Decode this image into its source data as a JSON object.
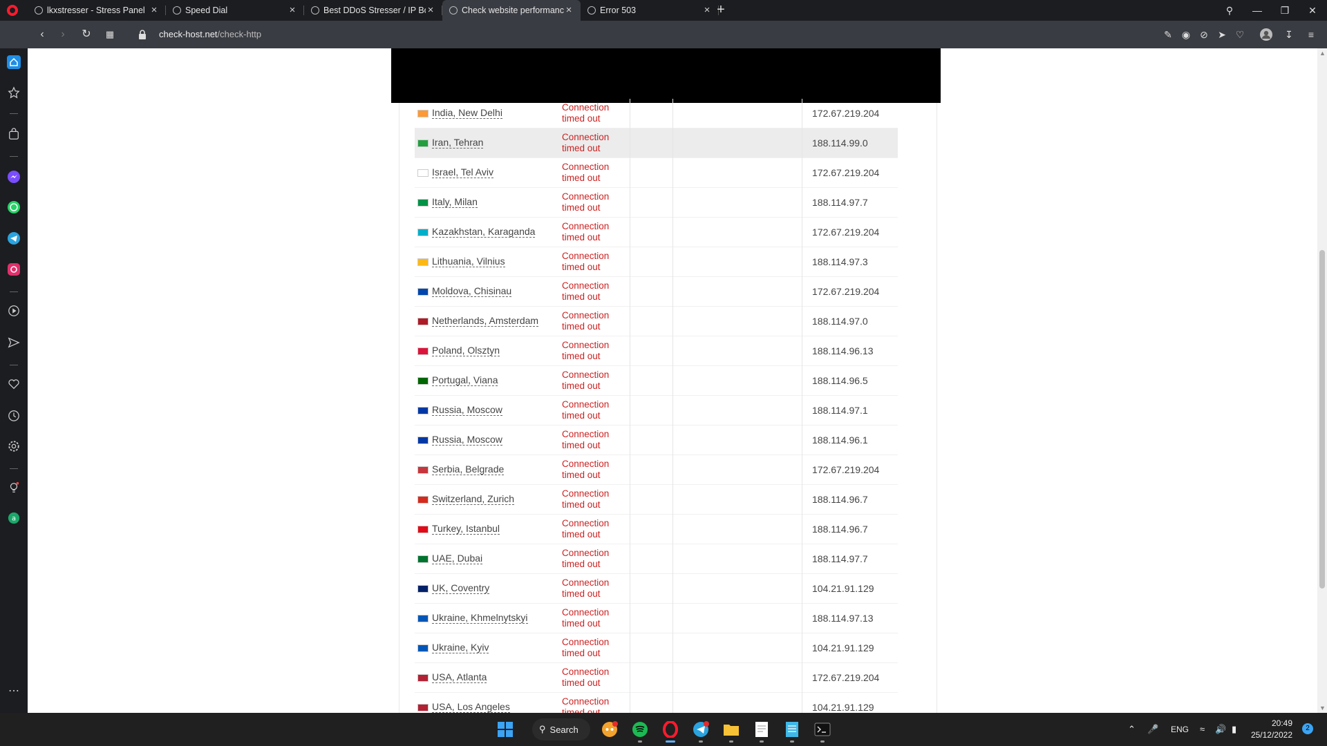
{
  "tabs": [
    {
      "label": "lkxstresser - Stress Panel",
      "active": false
    },
    {
      "label": "Speed Dial",
      "active": false
    },
    {
      "label": "Best DDoS Stresser / IP Boo",
      "active": false
    },
    {
      "label": "Check website performanc",
      "active": true
    },
    {
      "label": "Error 503",
      "active": false
    }
  ],
  "address_bar": {
    "domain": "check-host.net",
    "path": "/check-http"
  },
  "results": [
    {
      "location": "India, New Delhi",
      "flag": "india",
      "status": [
        "Connection",
        "timed out"
      ],
      "ip": "172.67.219.204",
      "highlight": false
    },
    {
      "location": "Iran, Tehran",
      "flag": "iran",
      "status": [
        "Connection",
        "timed out"
      ],
      "ip": "188.114.99.0",
      "highlight": true
    },
    {
      "location": "Israel, Tel Aviv",
      "flag": "israel",
      "status": [
        "Connection",
        "timed out"
      ],
      "ip": "172.67.219.204",
      "highlight": false
    },
    {
      "location": "Italy, Milan",
      "flag": "italy",
      "status": [
        "Connection",
        "timed out"
      ],
      "ip": "188.114.97.7",
      "highlight": false
    },
    {
      "location": "Kazakhstan, Karaganda",
      "flag": "kazakhstan",
      "status": [
        "Connection",
        "timed out"
      ],
      "ip": "172.67.219.204",
      "highlight": false
    },
    {
      "location": "Lithuania, Vilnius",
      "flag": "lithuania",
      "status": [
        "Connection",
        "timed out"
      ],
      "ip": "188.114.97.3",
      "highlight": false
    },
    {
      "location": "Moldova, Chisinau",
      "flag": "moldova",
      "status": [
        "Connection",
        "timed out"
      ],
      "ip": "172.67.219.204",
      "highlight": false
    },
    {
      "location": "Netherlands, Amsterdam",
      "flag": "netherlands",
      "status": [
        "Connection",
        "timed out"
      ],
      "ip": "188.114.97.0",
      "highlight": false
    },
    {
      "location": "Poland, Olsztyn",
      "flag": "poland",
      "status": [
        "Connection",
        "timed out"
      ],
      "ip": "188.114.96.13",
      "highlight": false
    },
    {
      "location": "Portugal, Viana",
      "flag": "portugal",
      "status": [
        "Connection",
        "timed out"
      ],
      "ip": "188.114.96.5",
      "highlight": false
    },
    {
      "location": "Russia, Moscow",
      "flag": "russia",
      "status": [
        "Connection",
        "timed out"
      ],
      "ip": "188.114.97.1",
      "highlight": false
    },
    {
      "location": "Russia, Moscow",
      "flag": "russia",
      "status": [
        "Connection",
        "timed out"
      ],
      "ip": "188.114.96.1",
      "highlight": false
    },
    {
      "location": "Serbia, Belgrade",
      "flag": "serbia",
      "status": [
        "Connection",
        "timed out"
      ],
      "ip": "172.67.219.204",
      "highlight": false
    },
    {
      "location": "Switzerland, Zurich",
      "flag": "switzerland",
      "status": [
        "Connection",
        "timed out"
      ],
      "ip": "188.114.96.7",
      "highlight": false
    },
    {
      "location": "Turkey, Istanbul",
      "flag": "turkey",
      "status": [
        "Connection",
        "timed out"
      ],
      "ip": "188.114.96.7",
      "highlight": false
    },
    {
      "location": "UAE, Dubai",
      "flag": "uae",
      "status": [
        "Connection",
        "timed out"
      ],
      "ip": "188.114.97.7",
      "highlight": false
    },
    {
      "location": "UK, Coventry",
      "flag": "uk",
      "status": [
        "Connection",
        "timed out"
      ],
      "ip": "104.21.91.129",
      "highlight": false
    },
    {
      "location": "Ukraine, Khmelnytskyi",
      "flag": "ukraine",
      "status": [
        "Connection",
        "timed out"
      ],
      "ip": "188.114.97.13",
      "highlight": false
    },
    {
      "location": "Ukraine, Kyiv",
      "flag": "ukraine",
      "status": [
        "Connection",
        "timed out"
      ],
      "ip": "104.21.91.129",
      "highlight": false
    },
    {
      "location": "USA, Atlanta",
      "flag": "usa",
      "status": [
        "Connection",
        "timed out"
      ],
      "ip": "172.67.219.204",
      "highlight": false
    },
    {
      "location": "USA, Los Angeles",
      "flag": "usa",
      "status": [
        "Connection",
        "timed out"
      ],
      "ip": "104.21.91.129",
      "highlight": false
    }
  ],
  "colors": {
    "status_error": "#cc2222",
    "accent": "#ff1b2d",
    "flag_colors": {
      "india": "#ff9933",
      "iran": "#239f40",
      "israel": "#ffffff",
      "italy": "#009246",
      "kazakhstan": "#00afca",
      "lithuania": "#fdb913",
      "moldova": "#0046ae",
      "netherlands": "#ae1c28",
      "poland": "#dc143c",
      "portugal": "#006600",
      "russia": "#0039a6",
      "serbia": "#c6363c",
      "switzerland": "#d52b1e",
      "turkey": "#e30a17",
      "uae": "#00732f",
      "uk": "#012169",
      "ukraine": "#0057b7",
      "usa": "#b22234"
    }
  },
  "taskbar": {
    "search_label": "Search",
    "language": "ENG",
    "time": "20:49",
    "date": "25/12/2022",
    "notification_count": "2",
    "apps": [
      "windows-start",
      "search",
      "discord",
      "spotify",
      "opera",
      "telegram",
      "file-explorer",
      "notepad",
      "notepad-plus",
      "terminal"
    ]
  },
  "sidebar_icons": [
    "home-icon",
    "star-icon",
    "bag-icon",
    "messenger-icon",
    "whatsapp-icon",
    "telegram-icon",
    "instagram-icon",
    "player-icon",
    "send-icon",
    "heart-icon",
    "history-icon",
    "settings-icon",
    "lightbulb-icon",
    "aria-icon",
    "more-icon"
  ]
}
